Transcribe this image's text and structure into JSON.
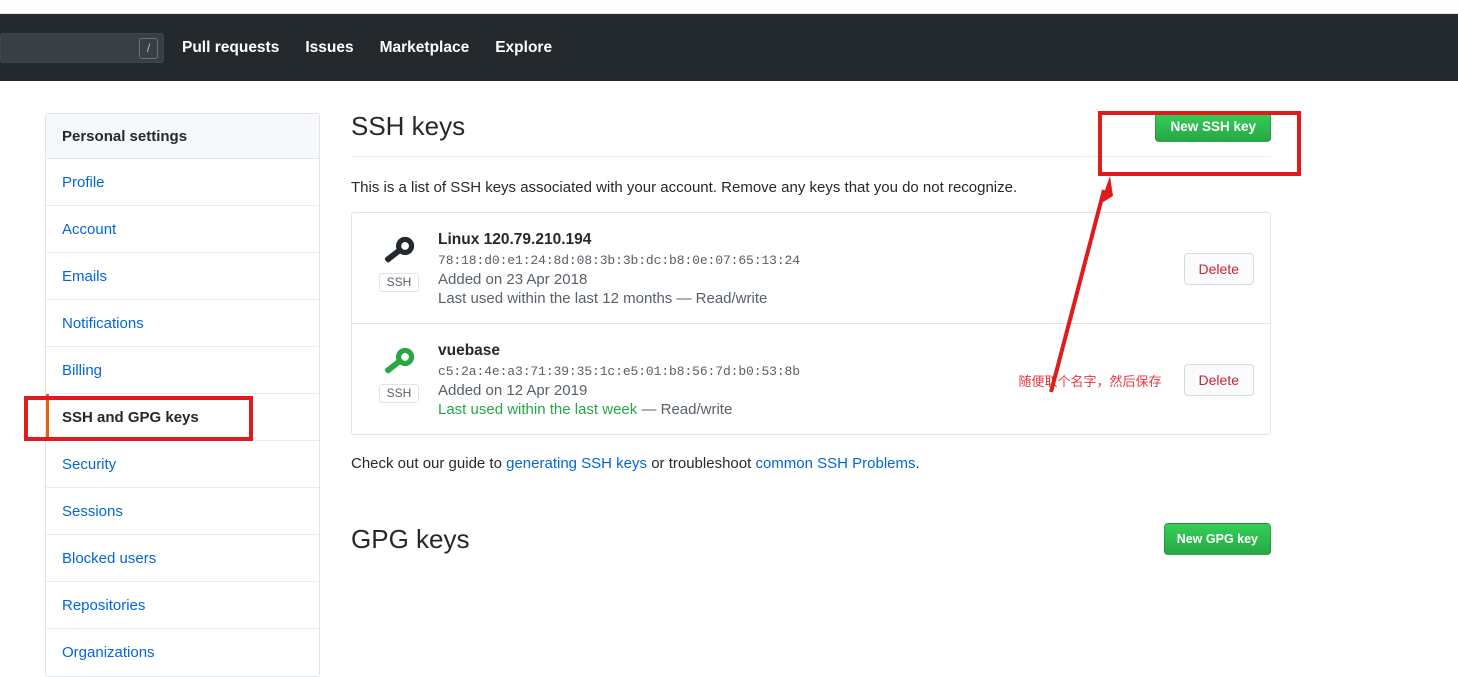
{
  "header": {
    "search": {
      "value": "",
      "placeholder": "",
      "shortcut_badge": "/"
    },
    "nav": [
      {
        "label": "Pull requests"
      },
      {
        "label": "Issues"
      },
      {
        "label": "Marketplace"
      },
      {
        "label": "Explore"
      }
    ],
    "background_color": "#24292e"
  },
  "sidebar": {
    "title": "Personal settings",
    "items": [
      {
        "label": "Profile",
        "active": false
      },
      {
        "label": "Account",
        "active": false
      },
      {
        "label": "Emails",
        "active": false
      },
      {
        "label": "Notifications",
        "active": false
      },
      {
        "label": "Billing",
        "active": false
      },
      {
        "label": "SSH and GPG keys",
        "active": true
      },
      {
        "label": "Security",
        "active": false
      },
      {
        "label": "Sessions",
        "active": false
      },
      {
        "label": "Blocked users",
        "active": false
      },
      {
        "label": "Repositories",
        "active": false
      },
      {
        "label": "Organizations",
        "active": false
      }
    ],
    "active_accent_color": "#e36209"
  },
  "ssh_section": {
    "title": "SSH keys",
    "new_button_label": "New SSH key",
    "description": "This is a list of SSH keys associated with your account. Remove any keys that you do not recognize.",
    "keys": [
      {
        "name": "Linux 120.79.210.194",
        "fingerprint": "78:18:d0:e1:24:8d:08:3b:3b:dc:b8:0e:07:65:13:24",
        "added": "Added on 23 Apr 2018",
        "last_used_prefix": "Last used within the last 12 months",
        "last_used_suffix": " — Read/write",
        "badge": "SSH",
        "icon_color": "#24292e",
        "recent": false,
        "delete_label": "Delete",
        "note": ""
      },
      {
        "name": "vuebase",
        "fingerprint": "c5:2a:4e:a3:71:39:35:1c:e5:01:b8:56:7d:b0:53:8b",
        "added": "Added on 12 Apr 2019",
        "last_used_prefix": "Last used within the last week",
        "last_used_suffix": " — Read/write",
        "badge": "SSH",
        "icon_color": "#28a745",
        "recent": true,
        "delete_label": "Delete",
        "note": "随便取个名字，然后保存"
      }
    ],
    "helper": {
      "prefix": "Check out our guide to ",
      "link1": "generating SSH keys",
      "middle": " or troubleshoot ",
      "link2": "common SSH Problems",
      "suffix": "."
    }
  },
  "gpg_section": {
    "title": "GPG keys",
    "new_button_label": "New GPG key"
  },
  "annotations": {
    "color": "#e01b1b",
    "boxes": [
      "new-ssh-key-button",
      "sidebar-ssh-and-gpg-keys"
    ],
    "arrow": "points-to-new-ssh-key-button"
  },
  "colors": {
    "green_button": "#2cbe4e",
    "link_blue": "#0366d6",
    "danger_red": "#cb2431",
    "annotation_red": "#e01b1b"
  }
}
